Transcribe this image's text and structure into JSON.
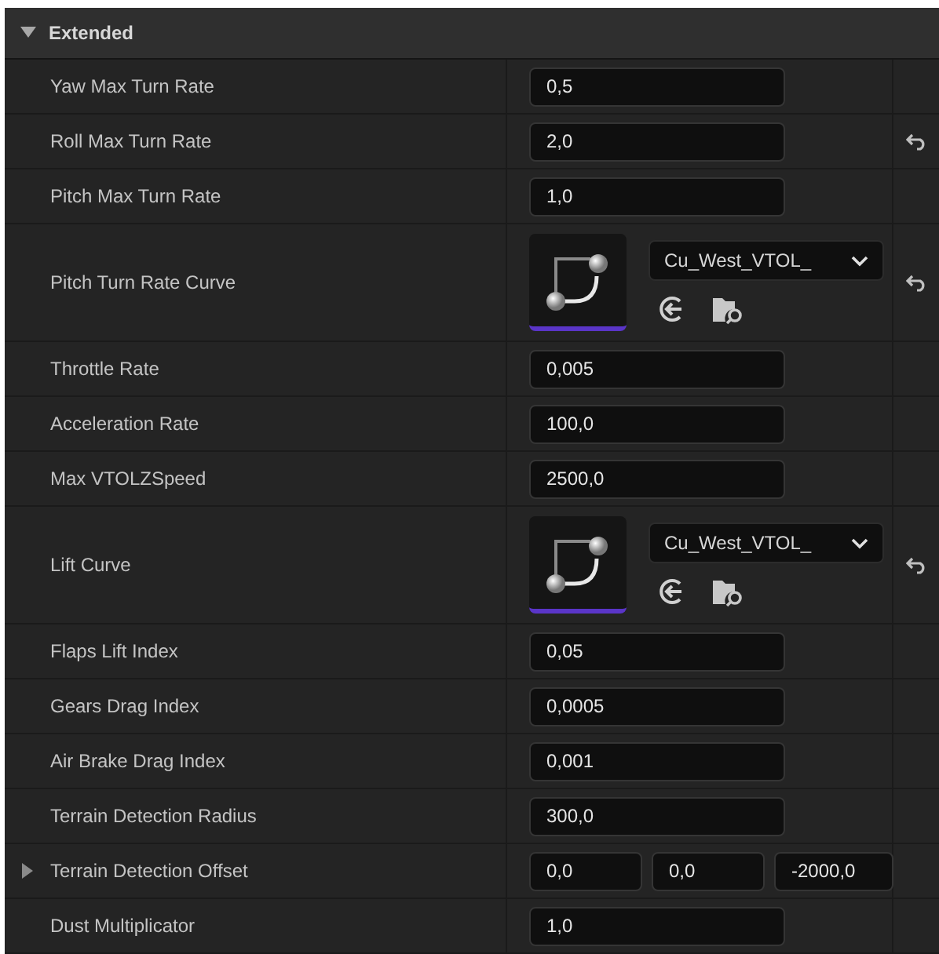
{
  "section": {
    "title": "Extended",
    "expanded": true
  },
  "rows": [
    {
      "label": "Yaw Max Turn Rate",
      "kind": "number",
      "value": "0,5",
      "reset": false
    },
    {
      "label": "Roll Max Turn Rate",
      "kind": "number",
      "value": "2,0",
      "reset": true
    },
    {
      "label": "Pitch Max Turn Rate",
      "kind": "number",
      "value": "1,0",
      "reset": false
    },
    {
      "label": "Pitch Turn Rate Curve",
      "kind": "curve",
      "value": "Cu_West_VTOL_",
      "reset": true
    },
    {
      "label": "Throttle Rate",
      "kind": "number",
      "value": "0,005",
      "reset": false
    },
    {
      "label": "Acceleration Rate",
      "kind": "number",
      "value": "100,0",
      "reset": false
    },
    {
      "label": "Max VTOLZSpeed",
      "kind": "number",
      "value": "2500,0",
      "reset": false
    },
    {
      "label": "Lift Curve",
      "kind": "curve",
      "value": "Cu_West_VTOL_",
      "reset": true
    },
    {
      "label": "Flaps Lift Index",
      "kind": "number",
      "value": "0,05",
      "reset": false
    },
    {
      "label": "Gears Drag Index",
      "kind": "number",
      "value": "0,0005",
      "reset": false
    },
    {
      "label": "Air Brake Drag Index",
      "kind": "number",
      "value": "0,001",
      "reset": false
    },
    {
      "label": "Terrain Detection Radius",
      "kind": "number",
      "value": "300,0",
      "reset": false
    },
    {
      "label": "Terrain Detection Offset",
      "kind": "vector",
      "values": [
        "0,0",
        "0,0",
        "-2000,0"
      ],
      "expanded": false,
      "reset": false
    },
    {
      "label": "Dust Multiplicator",
      "kind": "number",
      "value": "1,0",
      "reset": false
    }
  ]
}
